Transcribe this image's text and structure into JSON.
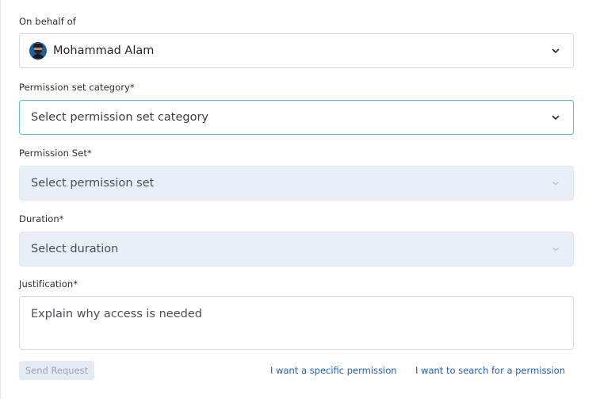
{
  "form": {
    "on_behalf_of": {
      "label": "On behalf of",
      "selected_user": "Mohammad Alam"
    },
    "permission_set_category": {
      "label": "Permission set category*",
      "placeholder": "Select permission set category"
    },
    "permission_set": {
      "label": "Permission Set*",
      "placeholder": "Select permission set"
    },
    "duration": {
      "label": "Duration*",
      "placeholder": "Select duration"
    },
    "justification": {
      "label": "Justification*",
      "placeholder": "Explain why access is needed"
    }
  },
  "actions": {
    "send_request": "Send Request",
    "specific_permission_link": "I want a specific permission",
    "search_permission_link": "I want to search for a permission"
  },
  "colors": {
    "focus_border": "#56bfe6",
    "disabled_fill": "#e9eef7",
    "link": "#1f5fc4"
  },
  "icons": {
    "dropdown": "chevron-down-icon",
    "user": "avatar"
  }
}
